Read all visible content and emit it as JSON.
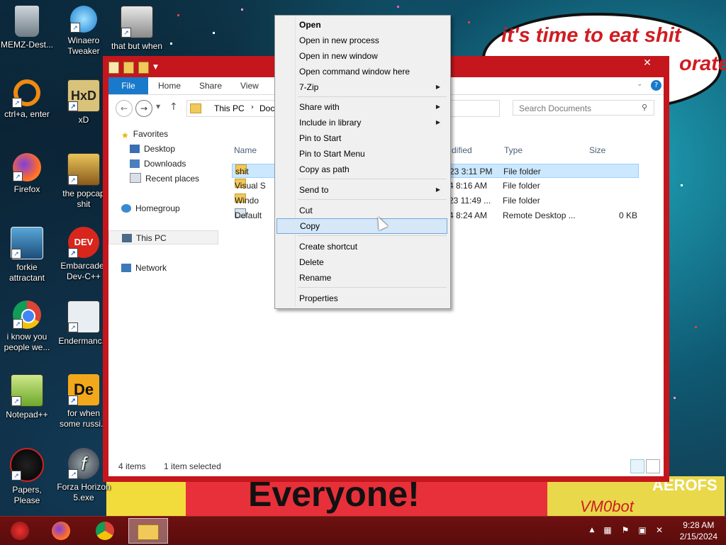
{
  "wallpaper": {
    "bubble_line1": "it's time to eat shit",
    "bubble_line2": "orate",
    "banner_text": "Everyone!",
    "banner_right": "AEROFS",
    "banner_ghost": "VM0bot"
  },
  "desktop_icons": [
    {
      "label": "MEMZ-Dest...",
      "icon": "recycle-bin-icon"
    },
    {
      "label": "Winaero Tweaker",
      "icon": "winaero-icon"
    },
    {
      "label": "that but when",
      "icon": "windows-stack-icon"
    },
    {
      "label": "ctrl+a, enter",
      "icon": "ring-icon"
    },
    {
      "label": "xD",
      "icon": "hxd-icon"
    },
    {
      "label": "Firefox",
      "icon": "firefox-icon"
    },
    {
      "label": "the popcap shit",
      "icon": "popcap-icon"
    },
    {
      "label": "forkie attractant",
      "icon": "network-gear-icon"
    },
    {
      "label": "Embarcader Dev-C++",
      "icon": "devcpp-icon"
    },
    {
      "label": "i know you people we...",
      "icon": "chrome-icon"
    },
    {
      "label": "Endermanc...",
      "icon": "endermanch-icon"
    },
    {
      "label": "Notepad++",
      "icon": "notepadpp-icon"
    },
    {
      "label": "for when some russi...",
      "icon": "de-icon"
    },
    {
      "label": "Papers, Please",
      "icon": "papers-please-icon"
    },
    {
      "label": "Forza Horizon 5.exe",
      "icon": "flash-icon"
    }
  ],
  "explorer": {
    "close_label": "✕",
    "tabs": {
      "file": "File",
      "home": "Home",
      "share": "Share",
      "view": "View"
    },
    "address": {
      "this_pc": "This PC",
      "docs": "Docu"
    },
    "search_placeholder": "Search Documents",
    "nav": {
      "favorites": "Favorites",
      "desktop": "Desktop",
      "downloads": "Downloads",
      "recent": "Recent places",
      "homegroup": "Homegroup",
      "this_pc": "This PC",
      "network": "Network"
    },
    "columns": {
      "name": "Name",
      "date": "dified",
      "type": "Type",
      "size": "Size"
    },
    "rows": [
      {
        "name": "shit",
        "date": "23 3:11 PM",
        "type": "File folder",
        "size": ""
      },
      {
        "name": "Visual S",
        "date": "4 8:16 AM",
        "type": "File folder",
        "size": ""
      },
      {
        "name": "Windo",
        "date": "23 11:49 ...",
        "type": "File folder",
        "size": ""
      },
      {
        "name": "Default",
        "date": "4 8:24 AM",
        "type": "Remote Desktop ...",
        "size": "0 KB"
      }
    ],
    "status_items": "4 items",
    "status_selected": "1 item selected"
  },
  "context_menu": {
    "items": [
      {
        "label": "Open",
        "bold": true,
        "submenu": false
      },
      {
        "label": "Open in new process",
        "submenu": false
      },
      {
        "label": "Open in new window",
        "submenu": false
      },
      {
        "label": "Open command window here",
        "submenu": false
      },
      {
        "label": "7-Zip",
        "submenu": true
      },
      {
        "label": "Share with",
        "submenu": true
      },
      {
        "label": "Include in library",
        "submenu": true
      },
      {
        "label": "Pin to Start",
        "submenu": false
      },
      {
        "label": "Pin to Start Menu",
        "submenu": false
      },
      {
        "label": "Copy as path",
        "submenu": false
      },
      {
        "label": "Send to",
        "submenu": true
      },
      {
        "label": "Cut",
        "submenu": false
      },
      {
        "label": "Copy",
        "submenu": false,
        "highlighted": true
      },
      {
        "label": "Create shortcut",
        "submenu": false
      },
      {
        "label": "Delete",
        "submenu": false
      },
      {
        "label": "Rename",
        "submenu": false
      },
      {
        "label": "Properties",
        "submenu": false
      }
    ],
    "submenu_glyph": "▶"
  },
  "taskbar": {
    "time": "9:28 AM",
    "date": "2/15/2024",
    "apps": [
      "memz-icon",
      "firefox-icon",
      "chrome-icon",
      "file-explorer-icon"
    ]
  },
  "colors": {
    "window_frame": "#c4161c",
    "ribbon_file_tab": "#1979ca",
    "selection": "#cce8ff",
    "taskbar": "#5a0c0c"
  }
}
